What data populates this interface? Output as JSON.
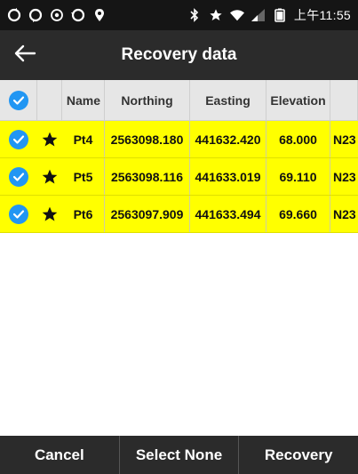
{
  "status_bar": {
    "time": "上午11:55",
    "left_icons": [
      "sync-icon",
      "sync-icon",
      "settings-icon",
      "sync-icon",
      "location-icon"
    ],
    "right_icons": [
      "bluetooth-icon",
      "star-icon",
      "wifi-icon",
      "signal-icon",
      "battery-icon"
    ]
  },
  "title_bar": {
    "title": "Recovery data",
    "back_icon": "arrow-left-icon"
  },
  "table": {
    "columns": [
      "Name",
      "Northing",
      "Easting",
      "Elevation"
    ],
    "rows": [
      {
        "name": "Pt4",
        "northing": "2563098.180",
        "easting": "441632.420",
        "elevation": "68.000",
        "extra": "N23"
      },
      {
        "name": "Pt5",
        "northing": "2563098.116",
        "easting": "441633.019",
        "elevation": "69.110",
        "extra": "N23"
      },
      {
        "name": "Pt6",
        "northing": "2563097.909",
        "easting": "441633.494",
        "elevation": "69.660",
        "extra": "N23"
      }
    ]
  },
  "bottom_bar": {
    "cancel": "Cancel",
    "select_none": "Select None",
    "recovery": "Recovery"
  },
  "colors": {
    "row_highlight": "#ffff00",
    "check_blue": "#2196f3",
    "bar_dark": "#2b2b2b"
  }
}
